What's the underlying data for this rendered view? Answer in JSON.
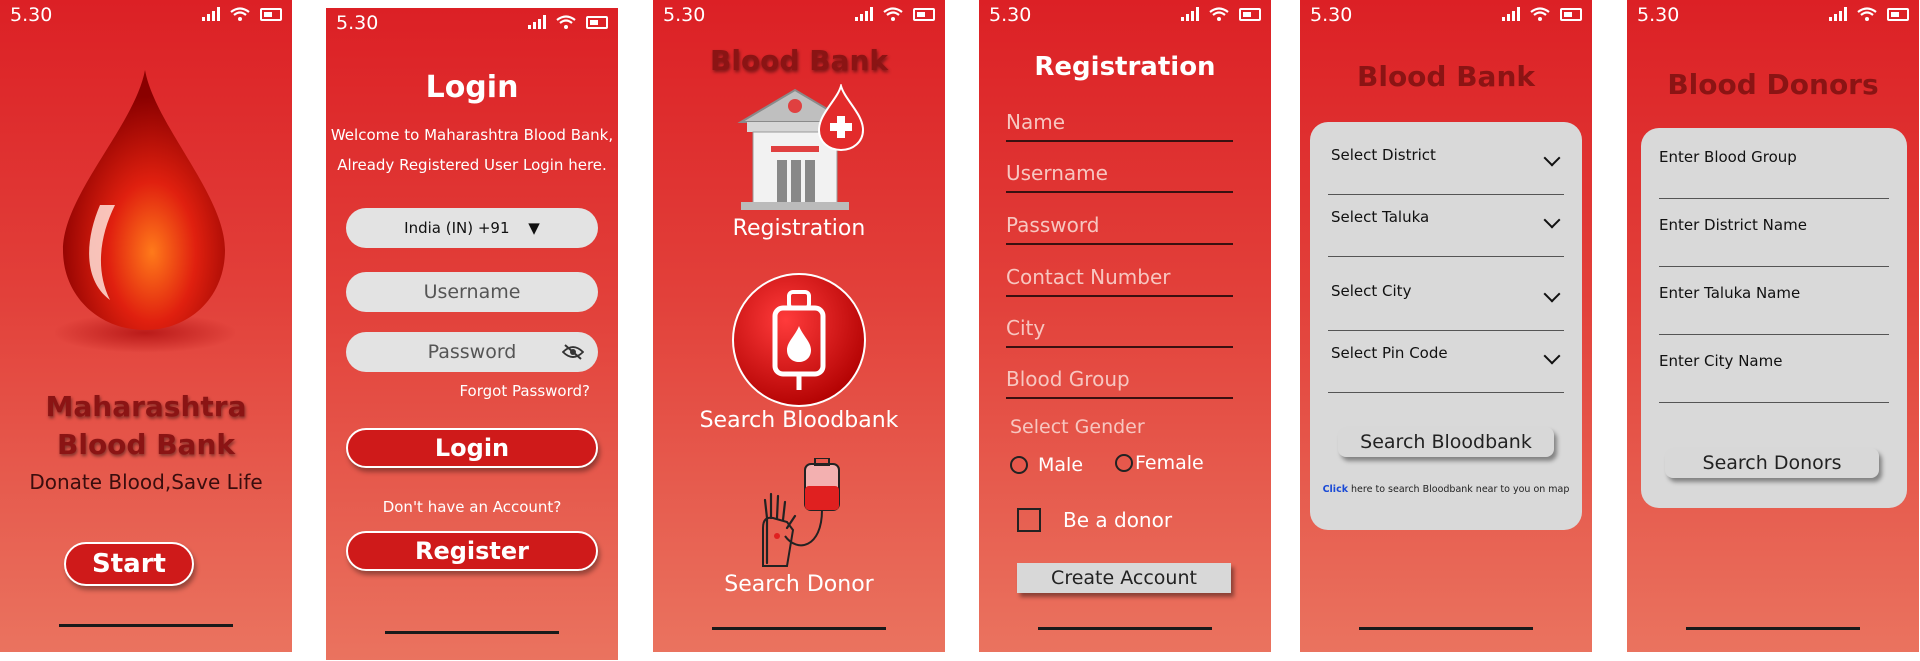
{
  "status": {
    "time": "5.30"
  },
  "splash": {
    "title_line1": "Maharashtra",
    "title_line2": "Blood Bank",
    "tagline": "Donate Blood,Save Life",
    "start_label": "Start"
  },
  "login": {
    "title": "Login",
    "welcome_line1": "Welcome to Maharashtra Blood Bank,",
    "welcome_line2": "Already Registered User Login here.",
    "country_value": "India (IN)  +91",
    "username_placeholder": "Username",
    "password_placeholder": "Password",
    "forgot_label": "Forgot Password?",
    "login_label": "Login",
    "no_account_text": "Don't have an Account?",
    "register_label": "Register"
  },
  "menu": {
    "title": "Blood Bank",
    "registration_label": "Registration",
    "search_bloodbank_label": "Search Bloodbank",
    "search_donor_label": "Search Donor"
  },
  "registration": {
    "title": "Registration",
    "fields": [
      "Name",
      "Username",
      "Password",
      "Contact Number",
      "City",
      "Blood Group"
    ],
    "gender_label": "Select Gender",
    "male_label": "Male",
    "female_label": "Female",
    "donor_label": "Be a donor",
    "create_label": "Create Account"
  },
  "bloodbank_search": {
    "title": "Blood Bank",
    "selects": [
      "Select District",
      "Select Taluka",
      "Select City",
      "Select Pin Code"
    ],
    "search_label": "Search Bloodbank",
    "click_word": "Click",
    "map_hint": " here to search Bloodbank near to you on map"
  },
  "donor_search": {
    "title": "Blood Donors",
    "fields": [
      "Enter Blood Group",
      "Enter District Name",
      "Enter Taluka Name",
      "Enter City Name"
    ],
    "search_label": "Search Donors"
  }
}
